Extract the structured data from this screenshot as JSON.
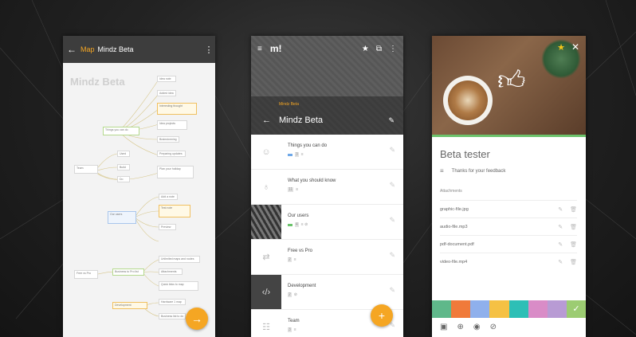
{
  "map_screen": {
    "back_label": "←",
    "breadcrumb_map": "Map",
    "breadcrumb_title": "Mindz Beta",
    "menu_label": "⋮",
    "map_title": "Mindz Beta",
    "nodes": [
      "Idea note",
      "Added idea",
      "Interesting thought",
      "Things you can do",
      "Idea projects",
      "Brainstorming",
      "Preparing updates",
      "Team",
      "Plan your holiday",
      "Used",
      "Build",
      "Do",
      "Add a note",
      "Our users",
      "Test note",
      "Preview",
      "Unlimited maps and nodes",
      "Attachments",
      "Free vs Pro",
      "Business to Pro list",
      "Quick links to map",
      "Development",
      "Hardware 1 map",
      "Business list to do"
    ],
    "fab_label": "→"
  },
  "list_screen": {
    "menu_label": "≡",
    "logo": "m!",
    "star_label": "★",
    "sitemap_label": "⧉",
    "more_label": "⋮",
    "subtitle": "Mindz Beta",
    "back_label": "←",
    "title": "Mindz Beta",
    "edit_label": "✎",
    "items": [
      {
        "name": "Things you can do",
        "count": "3"
      },
      {
        "name": "What you should know",
        "count": "11"
      },
      {
        "name": "Our users",
        "count": "4"
      },
      {
        "name": "Free vs Pro",
        "count": "2"
      },
      {
        "name": "Development",
        "count": "2"
      },
      {
        "name": "Team",
        "count": "3"
      }
    ],
    "fab_label": "+"
  },
  "detail_screen": {
    "star_label": "★",
    "close_label": "✕",
    "title": "Beta tester",
    "note_icon": "≡",
    "note": "Thanks for your feedback",
    "attachments_label": "Attachments",
    "files": [
      "graphic-file.jpg",
      "audio-file.mp3",
      "pdf-document.pdf",
      "video-file.mp4"
    ],
    "palette": [
      "#5fb88a",
      "#f07a3a",
      "#8fb0ec",
      "#f5c144",
      "#2dbfb6",
      "#d98cc7",
      "#b89bd4",
      "#9ccc72"
    ],
    "check_label": "✓",
    "bottom_icons": [
      "▣",
      "⊕",
      "◉",
      "⊘"
    ]
  }
}
